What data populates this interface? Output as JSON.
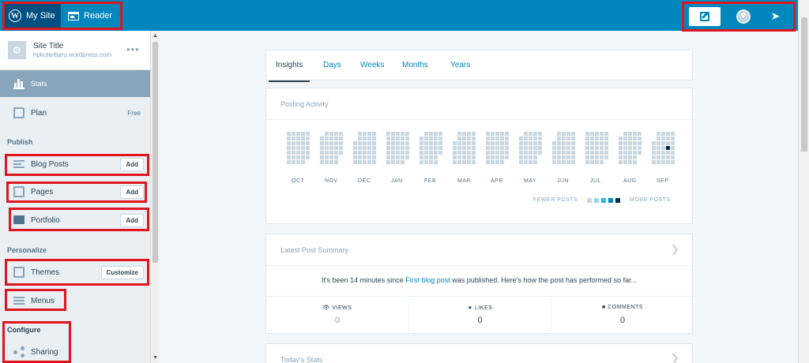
{
  "masterbar": {
    "my_site": "My Site",
    "reader": "Reader"
  },
  "site": {
    "title": "Site Title",
    "domain": "hpkuterbaru.wordpress.com"
  },
  "sidebar": {
    "stats": "Stats",
    "plan": "Plan",
    "plan_badge": "Free",
    "publish_header": "Publish",
    "blog_posts": "Blog Posts",
    "blog_posts_action": "Add",
    "pages": "Pages",
    "pages_action": "Add",
    "portfolio": "Portfolio",
    "portfolio_action": "Add",
    "personalize_header": "Personalize",
    "themes": "Themes",
    "themes_action": "Customize",
    "menus": "Menus",
    "configure_header": "Configure",
    "sharing": "Sharing"
  },
  "tabs": [
    {
      "label": "Insights"
    },
    {
      "label": "Days"
    },
    {
      "label": "Weeks"
    },
    {
      "label": "Months"
    },
    {
      "label": "Years"
    }
  ],
  "posting_activity": {
    "title": "Posting Activity",
    "months": [
      "OCT",
      "NOV",
      "DEC",
      "JAN",
      "FEB",
      "MAR",
      "APR",
      "MAY",
      "JUN",
      "JUL",
      "AUG",
      "SEP"
    ],
    "legend_fewer": "FEWER POSTS",
    "legend_more": "MORE POSTS",
    "legend_colors": [
      "#c8d7e1",
      "#87d9f2",
      "#2bb6e6",
      "#0087be",
      "#012d4d"
    ],
    "empty_color": "#c8d7e1",
    "active_color": "#012d4d"
  },
  "summary": {
    "title": "Latest Post Summary",
    "text_before": "It's been 14 minutes since ",
    "post_link": "First blog post",
    "text_after": " was published. Here's how the post has performed so far...",
    "views_label": "VIEWS",
    "views_value": "0",
    "likes_label": "LIKES",
    "likes_value": "0",
    "comments_label": "COMMENTS",
    "comments_value": "0"
  },
  "today": {
    "title": "Today's Stats"
  }
}
